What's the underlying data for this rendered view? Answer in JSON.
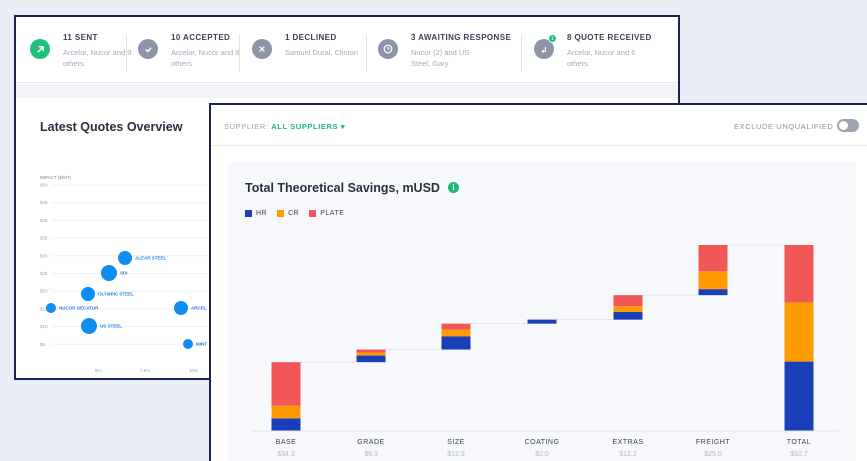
{
  "colors": {
    "hr": "#1a3fb8",
    "cr": "#ff9b00",
    "plate": "#f25757",
    "sent": "#21c07a",
    "neutral": "#8e95a8",
    "accent": "#1fb87a",
    "bubble": "#0f8df0"
  },
  "status": [
    {
      "icon": "arrow-up-right-icon",
      "title": "11 SENT",
      "sub": "Arcelor, Nucor and 9 others"
    },
    {
      "icon": "check-icon",
      "title": "10 ACCEPTED",
      "sub": "Arcelor, Nucor and 8 others"
    },
    {
      "icon": "close-icon",
      "title": "1 DECLINED",
      "sub": "Samuel Dural, Clinton"
    },
    {
      "icon": "clock-icon",
      "title": "3 AWAITING RESPONSE",
      "sub": "Nucor (2) and US Steel, Gary"
    },
    {
      "icon": "reply-icon",
      "title": "8 QUOTE RECEIVED",
      "sub": "Arcelor, Nucor and 6 others",
      "badge": "1"
    }
  ],
  "overview": {
    "title": "Latest Quotes Overview",
    "scatter": {
      "ylabel": "IMPACT ($/MT)",
      "yticks": [
        "$50",
        "$45",
        "$40",
        "$35",
        "$30",
        "$25",
        "$20",
        "$15",
        "$10",
        "$5"
      ],
      "xticks": [
        "5%",
        "7.5%",
        "10%"
      ],
      "points": [
        {
          "name": "ALEAR STEEL",
          "size": "m"
        },
        {
          "name": "SDI",
          "size": "l"
        },
        {
          "name": "OLYMPIC STEEL",
          "size": "m"
        },
        {
          "name": "NUCOR DECATUR",
          "size": "s"
        },
        {
          "name": "ARCEL",
          "size": "m"
        },
        {
          "name": "US STEEL",
          "size": "l"
        },
        {
          "name": "MINT",
          "size": "s"
        }
      ]
    }
  },
  "savings": {
    "supplier_label": "SUPPLIER:",
    "supplier_value": "ALL SUPPLIERS",
    "exclude_label": "EXCLUDE UNQUALIFIED",
    "title": "Total Theoretical Savings, mUSD",
    "info": "i",
    "legend": [
      "HR",
      "CR",
      "PLATE"
    ]
  },
  "chart_data": {
    "type": "bar",
    "subtype": "waterfall",
    "title": "Total Theoretical Savings, mUSD",
    "categories": [
      "BASE",
      "GRADE",
      "SIZE",
      "COATING",
      "EXTRAS",
      "FREIGHT",
      "TOTAL"
    ],
    "totals_labels": [
      "$34.3",
      "$6.3",
      "$12.9",
      "$2.0",
      "$12.2",
      "$25.0",
      "$92.7"
    ],
    "totals": [
      34.3,
      6.3,
      12.9,
      2.0,
      12.2,
      25.0,
      92.7
    ],
    "series": [
      {
        "name": "HR",
        "values": [
          6.3,
          3.3,
          6.6,
          2.0,
          3.8,
          3.0,
          34.6
        ]
      },
      {
        "name": "CR",
        "values": [
          6.3,
          1.5,
          3.3,
          0,
          2.9,
          8.9,
          29.5
        ]
      },
      {
        "name": "PLATE",
        "values": [
          21.7,
          1.5,
          3.0,
          0,
          5.5,
          13.1,
          28.6
        ]
      }
    ],
    "ylim": [
      0,
      92.7
    ],
    "grid": false,
    "legend": "top-left"
  }
}
